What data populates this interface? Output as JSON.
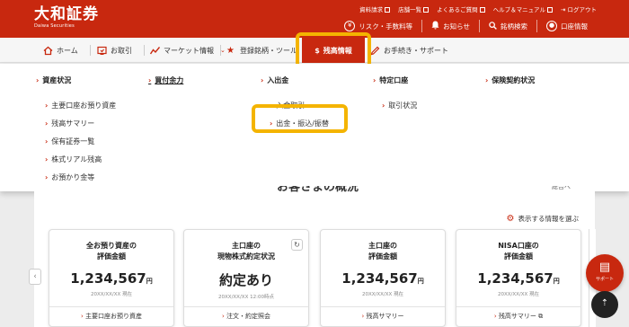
{
  "header": {
    "logo_text": "大和証券",
    "logo_sub": "Daiwa Securities",
    "util_links": [
      "資料請求",
      "店舗一覧",
      "よくあるご質問",
      "ヘルプ＆マニュアル",
      "ログアウト"
    ],
    "actions": [
      {
        "label": "リスク・手数料等",
        "icon": "coin-icon"
      },
      {
        "label": "お知らせ",
        "icon": "bell-icon"
      },
      {
        "label": "銘柄検索",
        "icon": "search-icon"
      },
      {
        "label": "口座情報",
        "icon": "user-icon"
      }
    ]
  },
  "nav": {
    "items": [
      "ホーム",
      "お取引",
      "マーケット情報",
      "登録銘柄・ツール",
      "残高情報",
      "お手続き・サポート"
    ],
    "active": "残高情報"
  },
  "mega_menu": {
    "col1": {
      "heading": "資産状況",
      "items": [
        "主要口座お預り資産",
        "残高サマリー",
        "保有証券一覧",
        "株式リアル残高",
        "お預かり金等"
      ]
    },
    "col2": {
      "heading": "買付余力"
    },
    "col3": {
      "heading": "入出金",
      "items": [
        "入金取引",
        "出金・振込/振替"
      ]
    },
    "col4": {
      "heading": "特定口座",
      "items": [
        "取引状況"
      ]
    },
    "col5": {
      "heading": "保険契約状況"
    }
  },
  "overview": {
    "title": "お客さまの概況",
    "more": "総合ペ",
    "display_setting": "表示する情報を選ぶ"
  },
  "cards": [
    {
      "title1": "全お預り資産の",
      "title2": "評価金額",
      "value": "1,234,567",
      "unit": "円",
      "date": "20XX/XX/XX 現在",
      "link": "主要口座お預り資産"
    },
    {
      "title1": "主口座の",
      "title2": "現物株式約定状況",
      "value": "約定あり",
      "unit": "",
      "date": "20XX/XX/XX 12:00時点",
      "link": "注文・約定照会"
    },
    {
      "title1": "主口座の",
      "title2": "評価金額",
      "value": "1,234,567",
      "unit": "円",
      "date": "20XX/XX/XX 現在",
      "link": "残高サマリー"
    },
    {
      "title1": "NISA口座の",
      "title2": "評価金額",
      "value": "1,234,567",
      "unit": "円",
      "date": "20XX/XX/XX 現在",
      "link": "残高サマリー"
    }
  ],
  "support": {
    "label": "サポート"
  }
}
